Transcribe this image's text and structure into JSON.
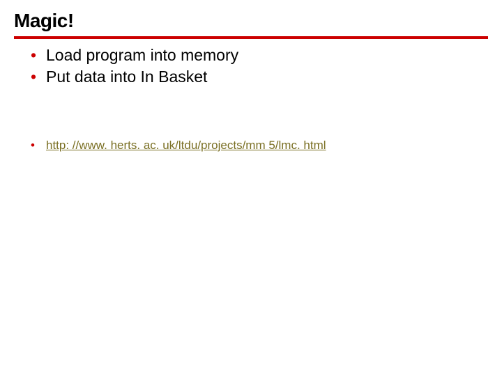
{
  "title": "Magic!",
  "bullets": [
    "Load program into memory",
    "Put data into In Basket"
  ],
  "link": {
    "text": "http: //www. herts. ac. uk/ltdu/projects/mm 5/lmc. html",
    "href": "http://www.herts.ac.uk/ltdu/projects/mm5/lmc.html"
  }
}
